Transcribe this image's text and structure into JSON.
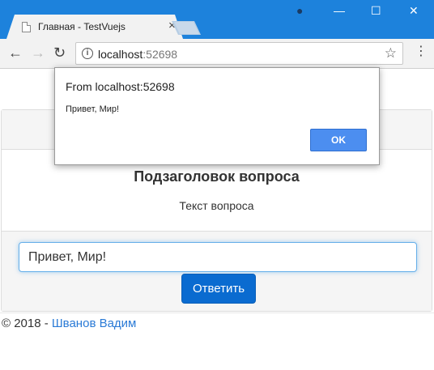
{
  "browser": {
    "tab_title": "Главная - TestVuejs",
    "tab_close": "×",
    "url_host": "localhost",
    "url_port": ":52698",
    "info_glyph": "i",
    "back_glyph": "←",
    "forward_glyph": "→",
    "reload_glyph": "↻",
    "star_glyph": "☆",
    "menu_glyph": "⋮",
    "minimize_glyph": "—",
    "maximize_glyph": "☐",
    "close_glyph": "✕",
    "profile_glyph": "●"
  },
  "question": {
    "subtitle": "Подзаголовок вопроса",
    "text": "Текст вопроса"
  },
  "answer": {
    "value": "Привет, Мир!",
    "submit_label": "Ответить"
  },
  "footer": {
    "copyright": "© 2018 - ",
    "author": "Шванов Вадим"
  },
  "alert": {
    "title": "From localhost:52698",
    "message": "Привет, Мир!",
    "ok_label": "OK"
  },
  "colors": {
    "chrome_accent": "#1d82dc",
    "primary_button": "#0a6bd0",
    "dialog_button": "#4c8ef0",
    "link": "#2a7ad6"
  }
}
